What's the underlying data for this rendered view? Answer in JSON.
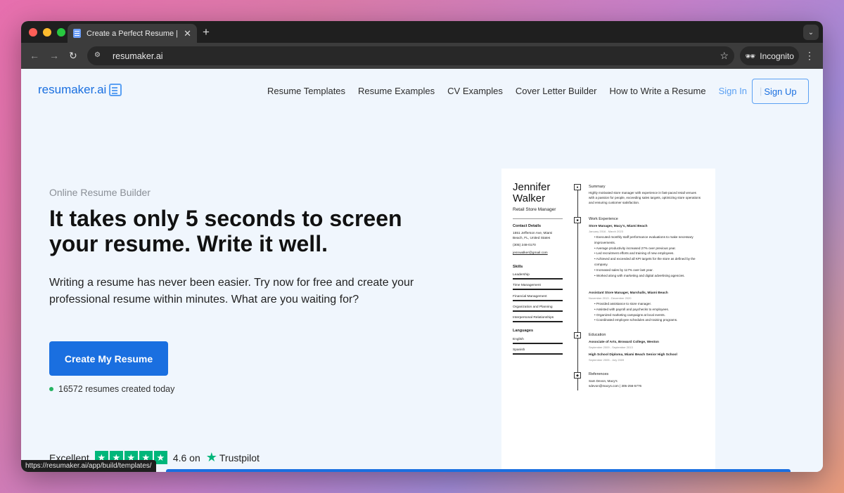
{
  "browser": {
    "tab_title": "Create a Perfect Resume | Fre",
    "tab_close": "✕",
    "new_tab": "+",
    "url": "resumaker.ai",
    "incognito_label": "Incognito",
    "status_url": "https://resumaker.ai/app/build/templates/"
  },
  "site": {
    "logo_text": "resumaker.ai",
    "nav": {
      "templates": "Resume Templates",
      "examples": "Resume Examples",
      "cv": "CV Examples",
      "cover": "Cover Letter Builder",
      "howto": "How to Write a Resume",
      "signin": "Sign In",
      "divider": "|"
    },
    "signup": "Sign Up"
  },
  "hero": {
    "eyebrow": "Online Resume Builder",
    "headline": "It takes only 5 seconds to screen your resume. Write it well.",
    "subtext": "Writing a resume has never been easier. Try now for free and create your professional resume within minutes. What are you waiting for?",
    "cta": "Create My Resume",
    "counter": "16572 resumes created today",
    "rating_word": "Excellent",
    "rating_stars": 5,
    "rating_value": "4.6 on",
    "trustpilot": "Trustpilot"
  },
  "resume": {
    "first_name": "Jennifer",
    "last_name": "Walker",
    "role": "Retail Store Manager",
    "contact_title": "Contact Details",
    "contact_1": "1551 Jefferson Ave, Miami",
    "contact_2": "Beach, FL, United States",
    "contact_3": "(305) 248-0170",
    "contact_4": "jennwalker@gmail.com",
    "skills_title": "Skills",
    "skills": [
      "Leadership",
      "Time Management",
      "Financial Management",
      "Organization and Planning",
      "Interpersonal Relationships"
    ],
    "languages_title": "Languages",
    "languages": [
      "English",
      "Spanish"
    ],
    "summary_title": "Summary",
    "summary": "Highly motivated store manager with experience in fast-paced retail venues with a passion for people, exceeding sales targets, optimizing store operations and ensuring customer satisfaction.",
    "work_title": "Work Experience",
    "job1_title": "Store Manager, Macy's, Miami Beach",
    "job1_date": "January 2016 - March 2023",
    "job1_bullets": [
      "Executed monthly staff performance evaluations to make necessary improvements.",
      "Average productivity increased 27% over previous year.",
      "Led recruitment efforts and training of new employees.",
      "Achieved and exceeded all KPI targets for the store as defined by the company.",
      "Increased sales by 117% over last year.",
      "Worked along with marketing and digital advertising agencies."
    ],
    "job2_title": "Assistant Store Manager, Marshalls, Miami Beach",
    "job2_date": "November 2013 - December 2020",
    "job2_bullets": [
      "Provided assistance to store manager.",
      "Assisted with payroll and paychecks to employees.",
      "Organized marketing campaigns at local events.",
      "Coordinated employee schedules and training programs."
    ],
    "edu_title": "Education",
    "edu1": "Associate of Arts, Broward College, Weston",
    "edu1_date": "September 2009 - September 2013",
    "edu2": "High School Diploma, Miami Beach Senior High School",
    "edu2_date": "September 2005 - July 2009",
    "ref_title": "References",
    "ref1": "Sam Devon, Macy's",
    "ref2": "sdevon@macys.com | 305-256-5776"
  },
  "colors": {
    "brand_blue": "#1a6fe0",
    "light_blue": "#5aa0f3",
    "trustpilot_green": "#00b67a",
    "status_green": "#25b361"
  }
}
